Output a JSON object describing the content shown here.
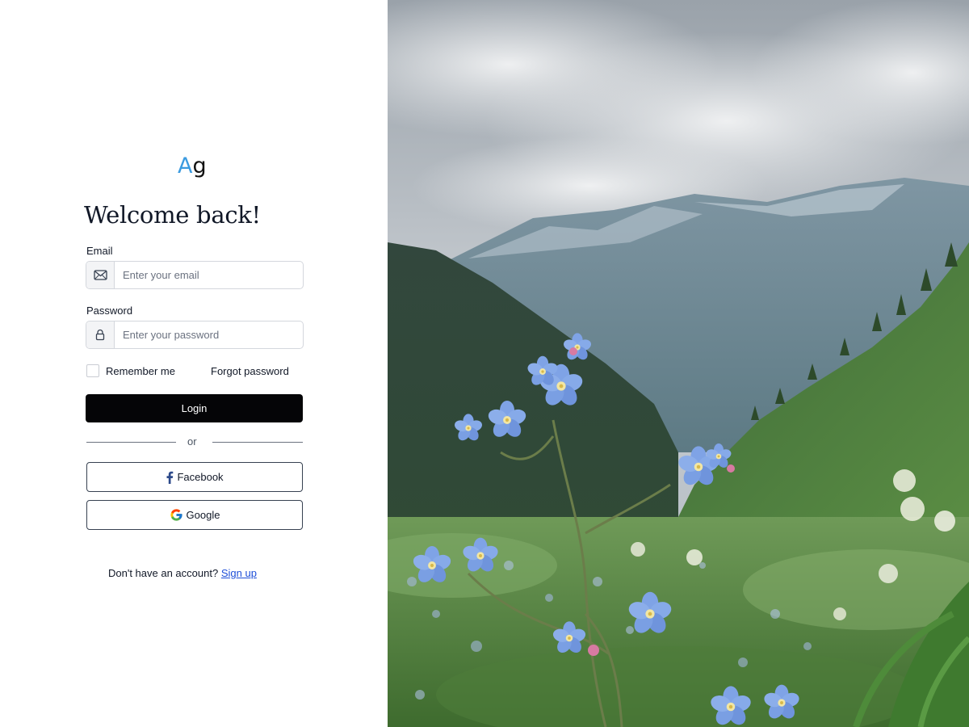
{
  "brand": {
    "logo_a": "A",
    "logo_g": "g",
    "accent_color": "#3b9be0"
  },
  "heading": "Welcome back!",
  "email": {
    "label": "Email",
    "placeholder": "Enter your email",
    "value": "",
    "icon": "envelope-icon"
  },
  "password": {
    "label": "Password",
    "placeholder": "Enter your password",
    "value": "",
    "icon": "lock-icon"
  },
  "remember": {
    "label": "Remember me",
    "checked": false
  },
  "forgot_label": "Forgot password",
  "login_label": "Login",
  "divider_text": "or",
  "social": {
    "facebook": {
      "label": "Facebook",
      "icon": "facebook-icon"
    },
    "google": {
      "label": "Google",
      "icon": "google-icon"
    }
  },
  "signup": {
    "prompt": "Don't have an account?",
    "link_label": "Sign up"
  },
  "hero_image": {
    "subject": "blue forget-me-not flowers in a mountain meadow"
  }
}
